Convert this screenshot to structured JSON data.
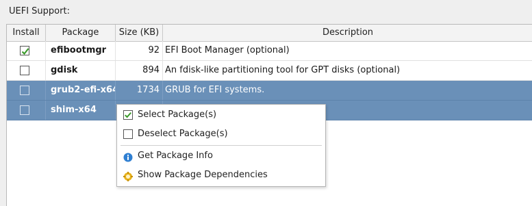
{
  "section": {
    "label": "UEFI Support:"
  },
  "table": {
    "headers": {
      "install": "Install",
      "package": "Package",
      "size": "Size (KB)",
      "description": "Description"
    },
    "rows": [
      {
        "installed": true,
        "package": "efibootmgr",
        "size": "92",
        "description": "EFI Boot Manager (optional)",
        "selected": false
      },
      {
        "installed": false,
        "package": "gdisk",
        "size": "894",
        "description": "An fdisk-like partitioning tool for GPT disks (optional)",
        "selected": false
      },
      {
        "installed": false,
        "package": "grub2-efi-x64",
        "size": "1734",
        "description": "GRUB for EFI systems.",
        "selected": true
      },
      {
        "installed": false,
        "package": "shim-x64",
        "size": "",
        "description": "",
        "selected": true
      }
    ]
  },
  "context_menu": {
    "items": [
      {
        "label": "Select Package(s)",
        "icon": "checked-checkbox-icon"
      },
      {
        "label": "Deselect Package(s)",
        "icon": "unchecked-checkbox-icon"
      },
      {
        "label": "Get Package Info",
        "icon": "info-icon"
      },
      {
        "label": "Show Package Dependencies",
        "icon": "dependencies-icon"
      }
    ]
  },
  "colors": {
    "selection": "#6a90b8",
    "check": "#3a9a2a",
    "info": "#2f7fd2",
    "deps": "#e8b21a"
  }
}
